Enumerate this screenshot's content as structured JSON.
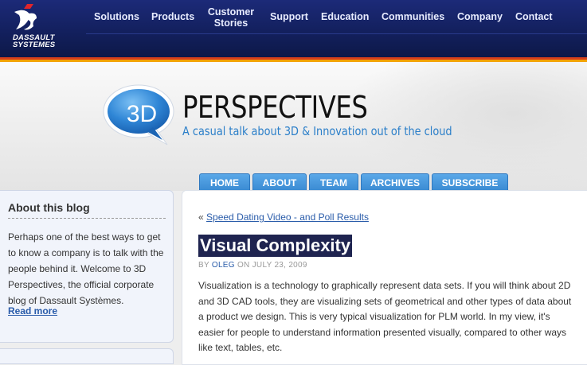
{
  "nav": {
    "brand_line1": "DASSAULT",
    "brand_line2": "SYSTEMES",
    "items": [
      "Solutions",
      "Products",
      "Customer Stories",
      "Support",
      "Education",
      "Communities",
      "Company",
      "Contact"
    ]
  },
  "banner": {
    "bubble_text": "3D",
    "title": "PERSPECTIVES",
    "tagline": "A casual talk about 3D & Innovation out of the cloud"
  },
  "tabs": [
    "HOME",
    "ABOUT",
    "TEAM",
    "ARCHIVES",
    "SUBSCRIBE"
  ],
  "sidebar": {
    "title": "About this blog",
    "text": "Perhaps one of the best ways to get to know a company is to talk with the people behind it. Welcome to 3D Perspectives, the official corporate blog of Dassault Systèmes.",
    "read_more": "Read more"
  },
  "post": {
    "prev_marker": "«",
    "prev_link": "Speed Dating Video - and Poll Results",
    "title": "Visual Complexity",
    "by": "BY",
    "author": "OLEG",
    "date": "ON JULY 23, 2009",
    "body": "Visualization is a technology to graphically represent data sets. If you will think about 2D and 3D CAD tools, they are visualizing sets of geometrical and other types of data about a product we design. This is very typical visualization for PLM world. In my view, it's easier for people to understand information presented visually, compared to other ways like text, tables, etc."
  },
  "colors": {
    "nav_bg": "#13205e",
    "accent_orange": "#d6401c",
    "tab_blue": "#3a8ad2",
    "tagline_blue": "#2b7fc9",
    "title_highlight": "#1f2450"
  }
}
